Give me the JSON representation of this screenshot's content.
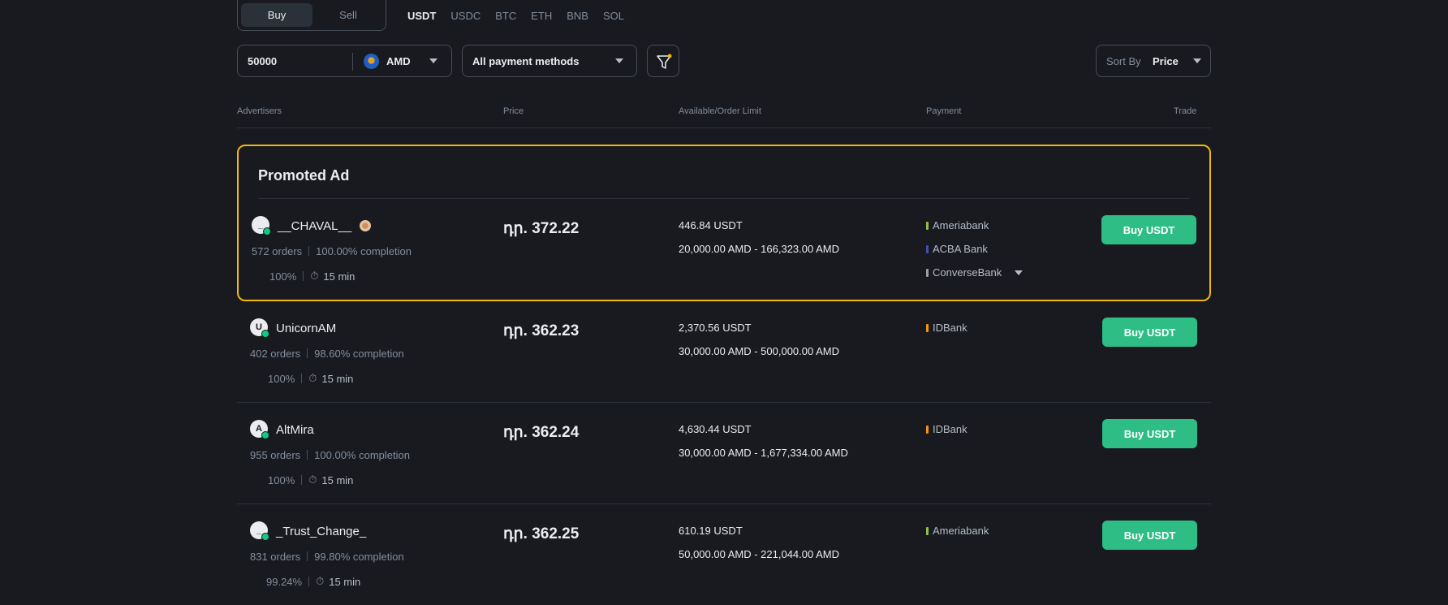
{
  "trade_toggle": {
    "buy": "Buy",
    "sell": "Sell"
  },
  "coins": [
    "USDT",
    "USDC",
    "BTC",
    "ETH",
    "BNB",
    "SOL"
  ],
  "filters": {
    "amount": "50000",
    "currency": "AMD",
    "payment": "All payment methods",
    "sort_label": "Sort By",
    "sort_value": "Price"
  },
  "columns": {
    "advertisers": "Advertisers",
    "price": "Price",
    "available": "Available/Order Limit",
    "payment": "Payment",
    "trade": "Trade"
  },
  "promo_title": "Promoted Ad",
  "ads": [
    {
      "avatar": "_",
      "name": "__CHAVAL__",
      "orders": "572 orders",
      "completion": "100.00% completion",
      "rating": "100%",
      "time": "15 min",
      "price": "դր. 372.22",
      "available": "446.84 USDT",
      "limit": "20,000.00 AMD - 166,323.00 AMD",
      "payments": [
        "Ameriabank",
        "ACBA Bank",
        "ConverseBank"
      ],
      "button": "Buy USDT"
    },
    {
      "avatar": "U",
      "name": "UnicornAM",
      "orders": "402 orders",
      "completion": "98.60% completion",
      "rating": "100%",
      "time": "15 min",
      "price": "դր. 362.23",
      "available": "2,370.56 USDT",
      "limit": "30,000.00 AMD - 500,000.00 AMD",
      "payments": [
        "IDBank"
      ],
      "button": "Buy USDT"
    },
    {
      "avatar": "A",
      "name": "AltMira",
      "orders": "955 orders",
      "completion": "100.00% completion",
      "rating": "100%",
      "time": "15 min",
      "price": "դր. 362.24",
      "available": "4,630.44 USDT",
      "limit": "30,000.00 AMD - 1,677,334.00 AMD",
      "payments": [
        "IDBank"
      ],
      "button": "Buy USDT"
    },
    {
      "avatar": "_",
      "name": "_Trust_Change_",
      "orders": "831 orders",
      "completion": "99.80% completion",
      "rating": "99.24%",
      "time": "15 min",
      "price": "դր. 362.25",
      "available": "610.19 USDT",
      "limit": "50,000.00 AMD - 221,044.00 AMD",
      "payments": [
        "Ameriabank"
      ],
      "button": "Buy USDT"
    }
  ],
  "colors": {
    "accent_green": "#2ebd85",
    "promo_border": "#f0b90b",
    "ameriabank": "#8bc34a",
    "acba": "#3f51b5",
    "converse": "#9e9e9e",
    "idbank": "#f7931a"
  }
}
